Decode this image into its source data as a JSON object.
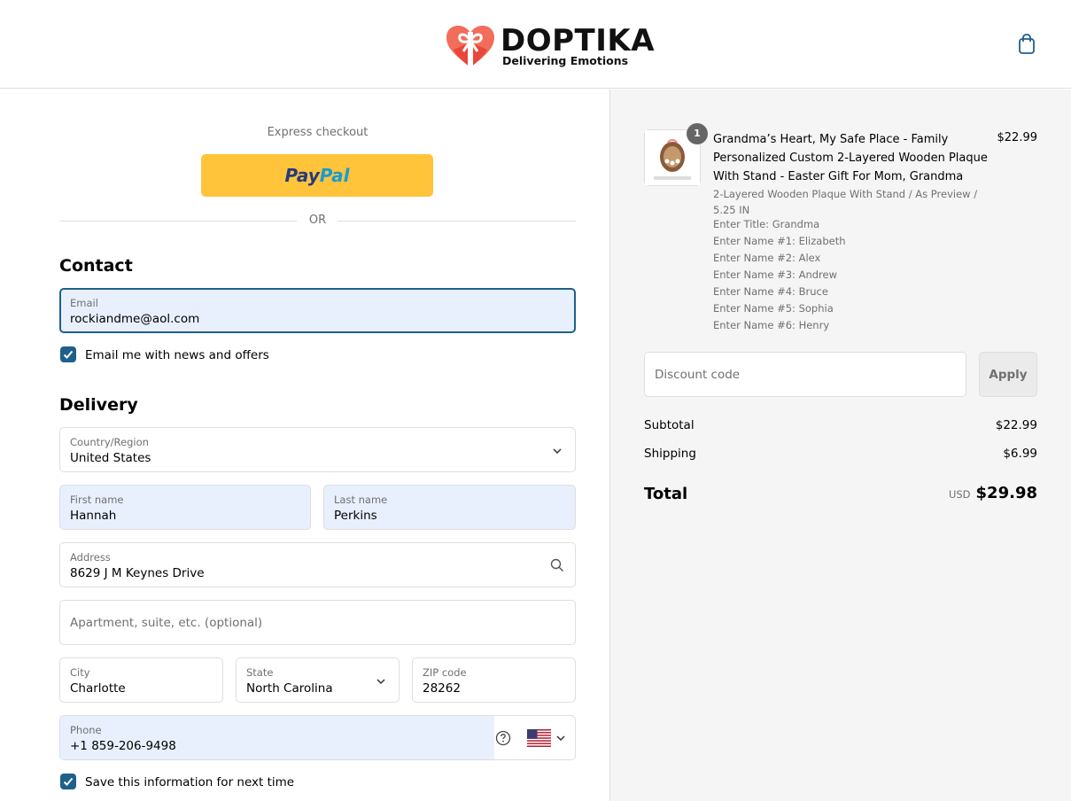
{
  "brand": {
    "name": "DOPTIKA",
    "tagline": "Delivering Emotions",
    "colors": {
      "heart": "#f26d5b",
      "accent": "#1f5f8b",
      "paypal_yellow": "#ffc43a"
    }
  },
  "header": {
    "cart_icon": "shopping-bag-icon"
  },
  "express": {
    "label": "Express checkout",
    "paypal_part1": "Pay",
    "paypal_part2": "Pal",
    "or_text": "OR"
  },
  "contact": {
    "heading": "Contact",
    "email_label": "Email",
    "email_value": "rockiandme@aol.com",
    "newsletter_label": "Email me with news and offers",
    "newsletter_checked": true
  },
  "delivery": {
    "heading": "Delivery",
    "country_label": "Country/Region",
    "country_value": "United States",
    "first_name_label": "First name",
    "first_name_value": "Hannah",
    "last_name_label": "Last name",
    "last_name_value": "Perkins",
    "address_label": "Address",
    "address_value": "8629 J M Keynes Drive",
    "apartment_placeholder": "Apartment, suite, etc. (optional)",
    "city_label": "City",
    "city_value": "Charlotte",
    "state_label": "State",
    "state_value": "North Carolina",
    "zip_label": "ZIP code",
    "zip_value": "28262",
    "phone_label": "Phone",
    "phone_value": "+1 859-206-9498",
    "save_info_label": "Save this information for next time",
    "save_info_checked": true
  },
  "summary": {
    "item": {
      "quantity": "1",
      "title": "Grandma’s Heart, My Safe Place - Family Personalized Custom 2-Layered Wooden Plaque With Stand - Easter Gift For Mom, Grandma",
      "price": "$22.99",
      "variant": "2-Layered Wooden Plaque With Stand / As Preview / 5.25 IN",
      "properties": [
        "Enter Title: Grandma",
        "Enter Name #1: Elizabeth",
        "Enter Name #2: Alex",
        "Enter Name #3: Andrew",
        "Enter Name #4: Bruce",
        "Enter Name #5: Sophia",
        "Enter Name #6: Henry"
      ]
    },
    "discount_placeholder": "Discount code",
    "apply_label": "Apply",
    "subtotal_label": "Subtotal",
    "subtotal_value": "$22.99",
    "shipping_label": "Shipping",
    "shipping_value": "$6.99",
    "total_label": "Total",
    "total_currency": "USD",
    "total_value": "$29.98"
  }
}
